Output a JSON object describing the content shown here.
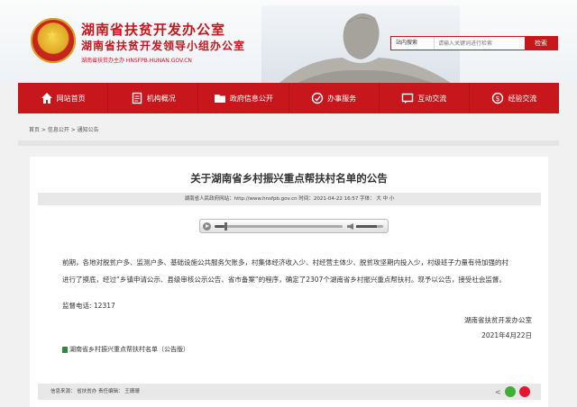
{
  "header": {
    "title": "湖南省扶贫开发办公室",
    "subtitle": "湖南省扶贫开发领导小组办公室",
    "host": "湖南省扶贫办主办 HNSFPB.HUNAN.GOV.CN",
    "search": {
      "scope": "站内搜索",
      "placeholder": "请输入关键词进行检索",
      "button": "检索"
    }
  },
  "nav": {
    "items": [
      {
        "label": "网站首页",
        "icon": "home-icon"
      },
      {
        "label": "机构概况",
        "icon": "document-icon"
      },
      {
        "label": "政府信息公开",
        "icon": "folder-icon"
      },
      {
        "label": "办事服务",
        "icon": "service-icon"
      },
      {
        "label": "互动交流",
        "icon": "chat-icon"
      },
      {
        "label": "经验交流",
        "icon": "exchange-icon"
      }
    ]
  },
  "breadcrumb": "首页 > 信息公开 > 通知公告",
  "article": {
    "title": "关于湖南省乡村振兴重点帮扶村名单的公告",
    "meta": "湖南省人民政府网站：http://www.hnsfpb.gov.cn    时间：2021-04-22 16:57    字体：  大  中  小",
    "player": {
      "progress": 0.08,
      "volume": 0.75
    },
    "paragraph": "前期，各地对脱贫户多、监测户多、基础设施公共服务欠账多，村集体经济收入少、村经营主体少、脱贫攻坚期内投入少，村级班子力量有待加强的村进行了摸底，经过“乡镇申请公示、县级审核公示公告、省市备案”的程序，确定了2307个湖南省乡村振兴重点帮扶村。现予以公告，接受社会监督。",
    "hotline": "监督电话: 12317",
    "signature_org": "湖南省扶贫开发办公室",
    "signature_date": "2021年4月22日",
    "attachment": "湖南省乡村振兴重点帮扶村名单（公告版）",
    "footer": "信息来源：  省扶贫办      责任编辑：  王珊珊"
  }
}
